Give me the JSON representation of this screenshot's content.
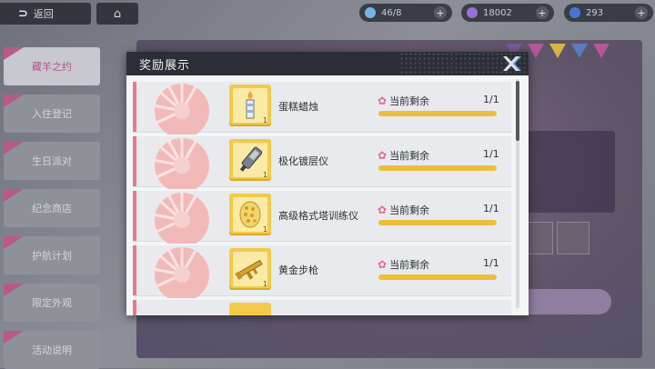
{
  "topbar": {
    "back_label": "返回",
    "home_icon": "home-icon",
    "resources": [
      {
        "icon": "stamina-icon",
        "value": "46/8",
        "color": "#6fb7e6"
      },
      {
        "icon": "crystal-icon",
        "value": "18002",
        "color": "#9b6fd6"
      },
      {
        "icon": "coin-icon",
        "value": "293",
        "color": "#4a74d9"
      }
    ]
  },
  "sidebar": {
    "items": [
      {
        "label": "藏羊之约",
        "active": true
      },
      {
        "label": "入住登记"
      },
      {
        "label": "生日派对"
      },
      {
        "label": "纪念商店"
      },
      {
        "label": "护航计划"
      },
      {
        "label": "限定外观"
      },
      {
        "label": "活动说明"
      }
    ]
  },
  "modal": {
    "title": "奖励展示",
    "close_icon": "close-x-icon",
    "remain_label": "当前剩余",
    "rows": [
      {
        "name": "蛋糕蜡烛",
        "count": "1/1",
        "progress": 1.0,
        "icon": "candle-icon",
        "qty": "1"
      },
      {
        "name": "极化镀层仪",
        "count": "1/1",
        "progress": 1.0,
        "icon": "polarizer-icon",
        "qty": "1"
      },
      {
        "name": "高级格式塔训练仪",
        "count": "1/1",
        "progress": 1.0,
        "icon": "gestalt-trainer-icon",
        "qty": "1"
      },
      {
        "name": "黄金步枪",
        "count": "1/1",
        "progress": 1.0,
        "icon": "golden-rifle-icon",
        "qty": "1"
      }
    ]
  },
  "colors": {
    "accent_pink": "#e07b8d",
    "item_gold": "#f3c94a",
    "progress_fill": "#ecbf3b",
    "header_dark": "#2b2e36"
  }
}
